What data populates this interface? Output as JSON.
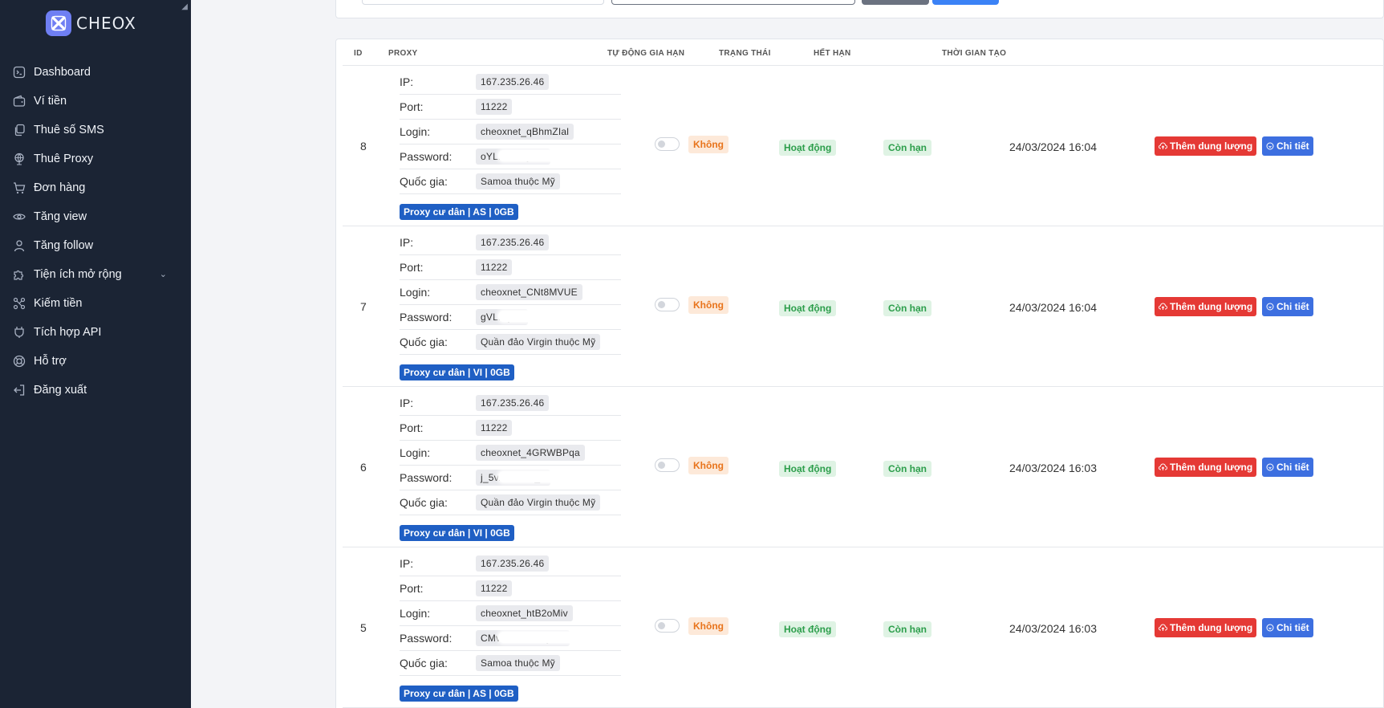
{
  "brand": {
    "name": "CHEOX"
  },
  "sidebar": {
    "items": [
      {
        "label": "Dashboard",
        "icon": "terminal-icon"
      },
      {
        "label": "Ví tiền",
        "icon": "wallet-icon"
      },
      {
        "label": "Thuê số SMS",
        "icon": "copy-icon"
      },
      {
        "label": "Thuê Proxy",
        "icon": "globe-icon"
      },
      {
        "label": "Đơn hàng",
        "icon": "cart-icon"
      },
      {
        "label": "Tăng view",
        "icon": "eye-icon"
      },
      {
        "label": "Tăng follow",
        "icon": "user-icon"
      },
      {
        "label": "Tiện ích mở rộng",
        "icon": "puzzle-icon",
        "has_submenu": true
      },
      {
        "label": "Kiếm tiền",
        "icon": "share-icon"
      },
      {
        "label": "Tích hợp API",
        "icon": "plugin-icon"
      },
      {
        "label": "Hỗ trợ",
        "icon": "lifebuoy-icon"
      },
      {
        "label": "Đăng xuất",
        "icon": "logout-icon"
      }
    ]
  },
  "table": {
    "headers": {
      "id": "ID",
      "proxy": "PROXY",
      "auto_renew": "TỰ ĐỘNG GIA HẠN",
      "status": "TRẠNG THÁI",
      "expiry": "HẾT HẠN",
      "created": "THỜI GIAN TẠO"
    },
    "field_labels": {
      "ip": "IP:",
      "port": "Port:",
      "login": "Login:",
      "password": "Password:",
      "country": "Quốc gia:"
    },
    "rows": [
      {
        "id": "8",
        "ip": "167.235.26.46",
        "port": "11222",
        "login": "cheoxnet_qBhmZIal",
        "password": "oYLKCKL             y-as",
        "country": "Samoa thuộc Mỹ",
        "proxy_tag": "Proxy cư dân | AS | 0GB",
        "auto_renew": "Không",
        "status": "Hoạt động",
        "expiry": "Còn hạn",
        "created": "24/03/2024 16:04",
        "add_label": "Thêm dung lượng",
        "detail_label": "Chi tiết"
      },
      {
        "id": "7",
        "ip": "167.235.26.46",
        "port": "11222",
        "login": "cheoxnet_CNt8MVUE",
        "password": "gVLB                y-vi",
        "country": "Quần đảo Virgin thuộc Mỹ",
        "proxy_tag": "Proxy cư dân | VI | 0GB",
        "auto_renew": "Không",
        "status": "Hoạt động",
        "expiry": "Còn hạn",
        "created": "24/03/2024 16:04",
        "add_label": "Thêm dung lượng",
        "detail_label": "Chi tiết"
      },
      {
        "id": "6",
        "ip": "167.235.26.46",
        "port": "11222",
        "login": "cheoxnet_4GRWBPqa",
        "password": "j_5vArhdbW_             i",
        "country": "Quần đảo Virgin thuộc Mỹ",
        "proxy_tag": "Proxy cư dân | VI | 0GB",
        "auto_renew": "Không",
        "status": "Hoạt động",
        "expiry": "Còn hạn",
        "created": "24/03/2024 16:03",
        "add_label": "Thêm dung lượng",
        "detail_label": "Chi tiết"
      },
      {
        "id": "5",
        "ip": "167.235.26.46",
        "port": "11222",
        "login": "cheoxnet_htB2oMiv",
        "password": "CMvV6t          country-as",
        "country": "Samoa thuộc Mỹ",
        "proxy_tag": "Proxy cư dân | AS | 0GB",
        "auto_renew": "Không",
        "status": "Hoạt động",
        "expiry": "Còn hạn",
        "created": "24/03/2024 16:03",
        "add_label": "Thêm dung lượng",
        "detail_label": "Chi tiết"
      }
    ]
  }
}
